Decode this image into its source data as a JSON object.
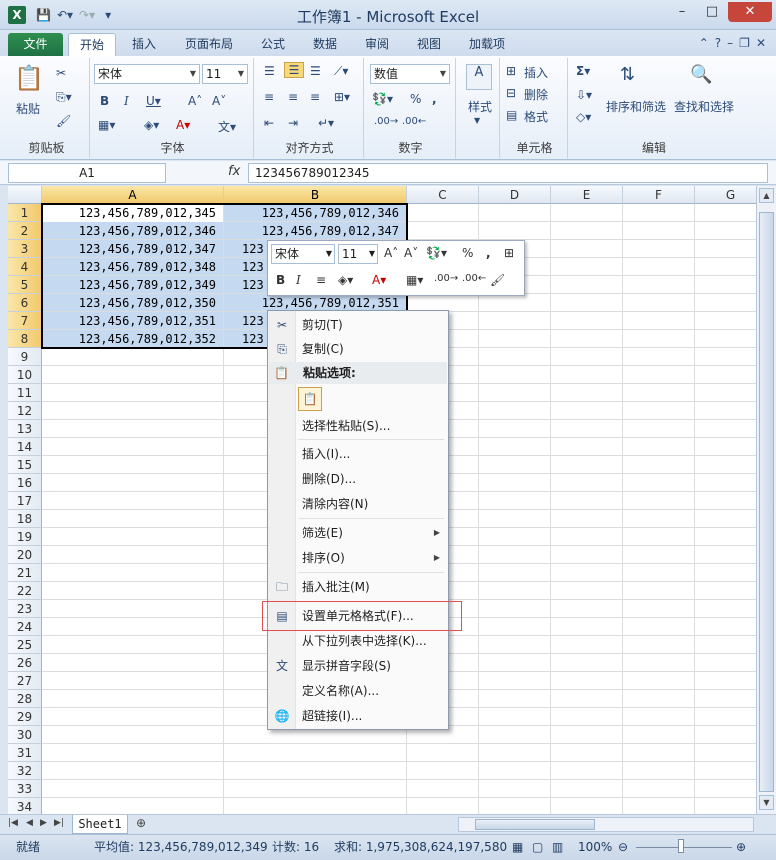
{
  "window": {
    "title": "工作簿1 - Microsoft Excel",
    "app_icon": "X"
  },
  "tabs": [
    {
      "label": "文件"
    },
    {
      "label": "开始"
    },
    {
      "label": "插入"
    },
    {
      "label": "页面布局"
    },
    {
      "label": "公式"
    },
    {
      "label": "数据"
    },
    {
      "label": "审阅"
    },
    {
      "label": "视图"
    },
    {
      "label": "加载项"
    }
  ],
  "ribbon": {
    "clipboard": {
      "label": "剪贴板",
      "paste": "粘贴"
    },
    "font": {
      "label": "字体",
      "name": "宋体",
      "size": "11"
    },
    "alignment": {
      "label": "对齐方式"
    },
    "number": {
      "label": "数字",
      "format": "数值"
    },
    "styles": {
      "label": "样式"
    },
    "cells": {
      "label": "单元格",
      "insert": "插入",
      "delete": "删除",
      "format": "格式"
    },
    "editing": {
      "label": "编辑",
      "sort_filter": "排序和筛选",
      "find_select": "查找和选择"
    }
  },
  "formula_bar": {
    "name_box": "A1",
    "fx": "fx",
    "value": "123456789012345"
  },
  "columns": [
    "A",
    "B",
    "C",
    "D",
    "E",
    "F",
    "G"
  ],
  "rows": [
    "1",
    "2",
    "3",
    "4",
    "5",
    "6",
    "7",
    "8",
    "9",
    "10",
    "11",
    "12",
    "13",
    "14",
    "15",
    "16",
    "17",
    "18",
    "19",
    "20",
    "21",
    "22",
    "23",
    "24",
    "25",
    "26",
    "27",
    "28",
    "29",
    "30",
    "31",
    "32",
    "33",
    "34"
  ],
  "cells": {
    "A": [
      "123,456,789,012,345",
      "123,456,789,012,346",
      "123,456,789,012,347",
      "123,456,789,012,348",
      "123,456,789,012,349",
      "123,456,789,012,350",
      "123,456,789,012,351",
      "123,456,789,012,352"
    ],
    "B_row1": "123,456,789,012,346",
    "B_row2": "123,456,789,012,347",
    "B_row6": "123,456,789,012,351",
    "B_partial": [
      "123",
      "123",
      "123",
      "123",
      "123",
      "123"
    ]
  },
  "mini_toolbar": {
    "font": "宋体",
    "size": "11"
  },
  "context_menu": {
    "cut": "剪切(T)",
    "copy": "复制(C)",
    "paste_options": "粘贴选项:",
    "paste_special": "选择性粘贴(S)...",
    "insert": "插入(I)...",
    "delete": "删除(D)...",
    "clear": "清除内容(N)",
    "filter": "筛选(E)",
    "sort": "排序(O)",
    "comment": "插入批注(M)",
    "format_cells": "设置单元格格式(F)...",
    "pick_list": "从下拉列表中选择(K)...",
    "phonetic": "显示拼音字段(S)",
    "define_name": "定义名称(A)...",
    "hyperlink": "超链接(I)..."
  },
  "sheet_tab": "Sheet1",
  "status": {
    "mode": "就绪",
    "average": "平均值: 123,456,789,012,349",
    "count": "计数: 16",
    "sum": "求和: 1,975,308,624,197,580",
    "zoom": "100%"
  }
}
